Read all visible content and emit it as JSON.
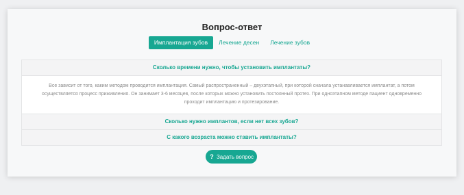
{
  "title": "Вопрос-ответ",
  "tabs": [
    {
      "label": "Имплантация зубов",
      "active": true
    },
    {
      "label": "Лечение десен",
      "active": false
    },
    {
      "label": "Лечение зубов",
      "active": false
    }
  ],
  "faq": [
    {
      "question": "Сколько времени нужно, чтобы установить имплантаты?",
      "answer": "Все зависит от того, каким методом проводится имплантация. Самый распространенный – двухэтапный, при которой сначала устанавливается имплантат, а потом осуществляется процесс приживления. Он занимает 3-6 месяцев, после которых можно установить постоянный протез. При одноэтапном методе пациент одновременно проходит имплантацию и протезирование."
    },
    {
      "question": "Сколько нужно имплантов, если нет всех зубов?"
    },
    {
      "question": "С какого возраста можно ставить имплантаты?"
    }
  ],
  "ask_button": {
    "label": "Задать вопрос",
    "icon": "question-icon"
  },
  "colors": {
    "accent": "#17a792",
    "background": "#eff0f2",
    "card": "#f7f8f9"
  }
}
